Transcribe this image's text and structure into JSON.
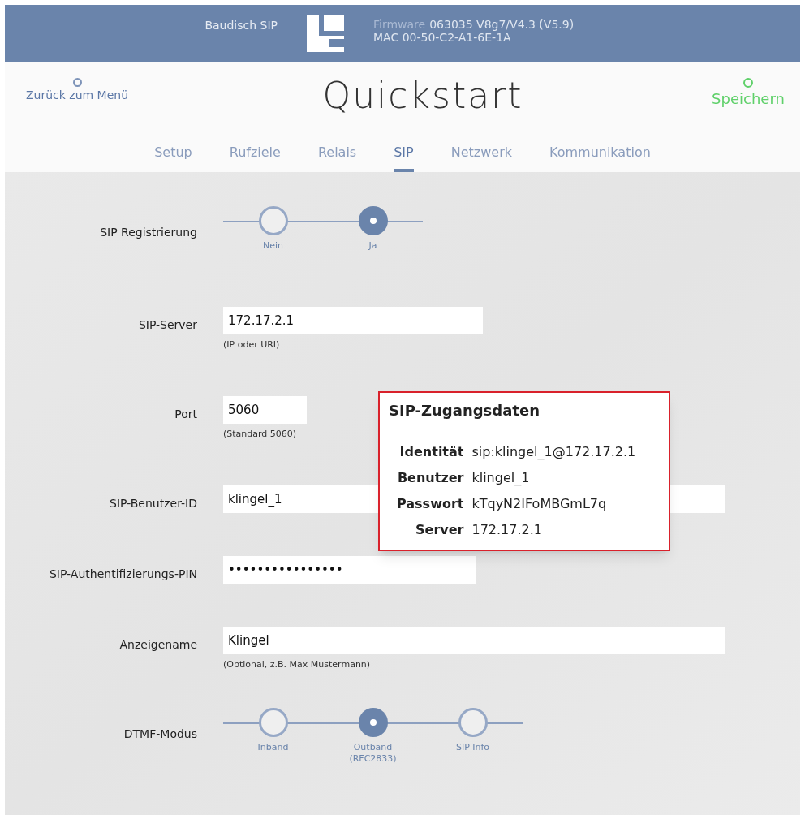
{
  "header": {
    "product": "Baudisch SIP",
    "firmware_label": "Firmware",
    "firmware": "063035 V8g7/V4.3 (V5.9)",
    "mac": "MAC 00-50-C2-A1-6E-1A"
  },
  "nav": {
    "back": "Zurück zum Menü",
    "title": "Quickstart",
    "save": "Speichern"
  },
  "tabs": [
    {
      "label": "Setup",
      "selected": false
    },
    {
      "label": "Rufziele",
      "selected": false
    },
    {
      "label": "Relais",
      "selected": false
    },
    {
      "label": "SIP",
      "selected": true
    },
    {
      "label": "Netzwerk",
      "selected": false
    },
    {
      "label": "Kommunikation",
      "selected": false
    }
  ],
  "form": [
    {
      "kind": "radio",
      "label": "SIP Registrierung",
      "options": [
        {
          "label": "Nein",
          "selected": false
        },
        {
          "label": "Ja",
          "selected": true
        }
      ]
    },
    {
      "kind": "input",
      "label": "SIP-Server",
      "value": "172.17.2.1",
      "hint": "(IP oder URI)"
    },
    {
      "kind": "input",
      "label": "Port",
      "value": "5060",
      "hint": "(Standard 5060)"
    },
    {
      "kind": "input",
      "label": "SIP-Benutzer-ID",
      "value": "klingel_1"
    },
    {
      "kind": "input",
      "label": "SIP-Authentifizierungs-PIN",
      "value": "••••••••••••••••"
    },
    {
      "kind": "input",
      "label": "Anzeigename",
      "value": "Klingel",
      "hint": "(Optional, z.B. Max Mustermann)"
    },
    {
      "kind": "radio",
      "label": "DTMF-Modus",
      "options": [
        {
          "label": "Inband",
          "selected": false
        },
        {
          "label": "Outband (RFC2833)",
          "selected": true
        },
        {
          "label": "SIP Info",
          "selected": false
        }
      ]
    }
  ],
  "popup": {
    "title": "SIP-Zugangsdaten",
    "rows": [
      {
        "key": "Identität",
        "value": "sip:klingel_1@172.17.2.1"
      },
      {
        "key": "Benutzer",
        "value": "klingel_1"
      },
      {
        "key": "Passwort",
        "value": "kTqyN2IFoMBGmL7q"
      },
      {
        "key": "Server",
        "value": "172.17.2.1"
      }
    ]
  }
}
